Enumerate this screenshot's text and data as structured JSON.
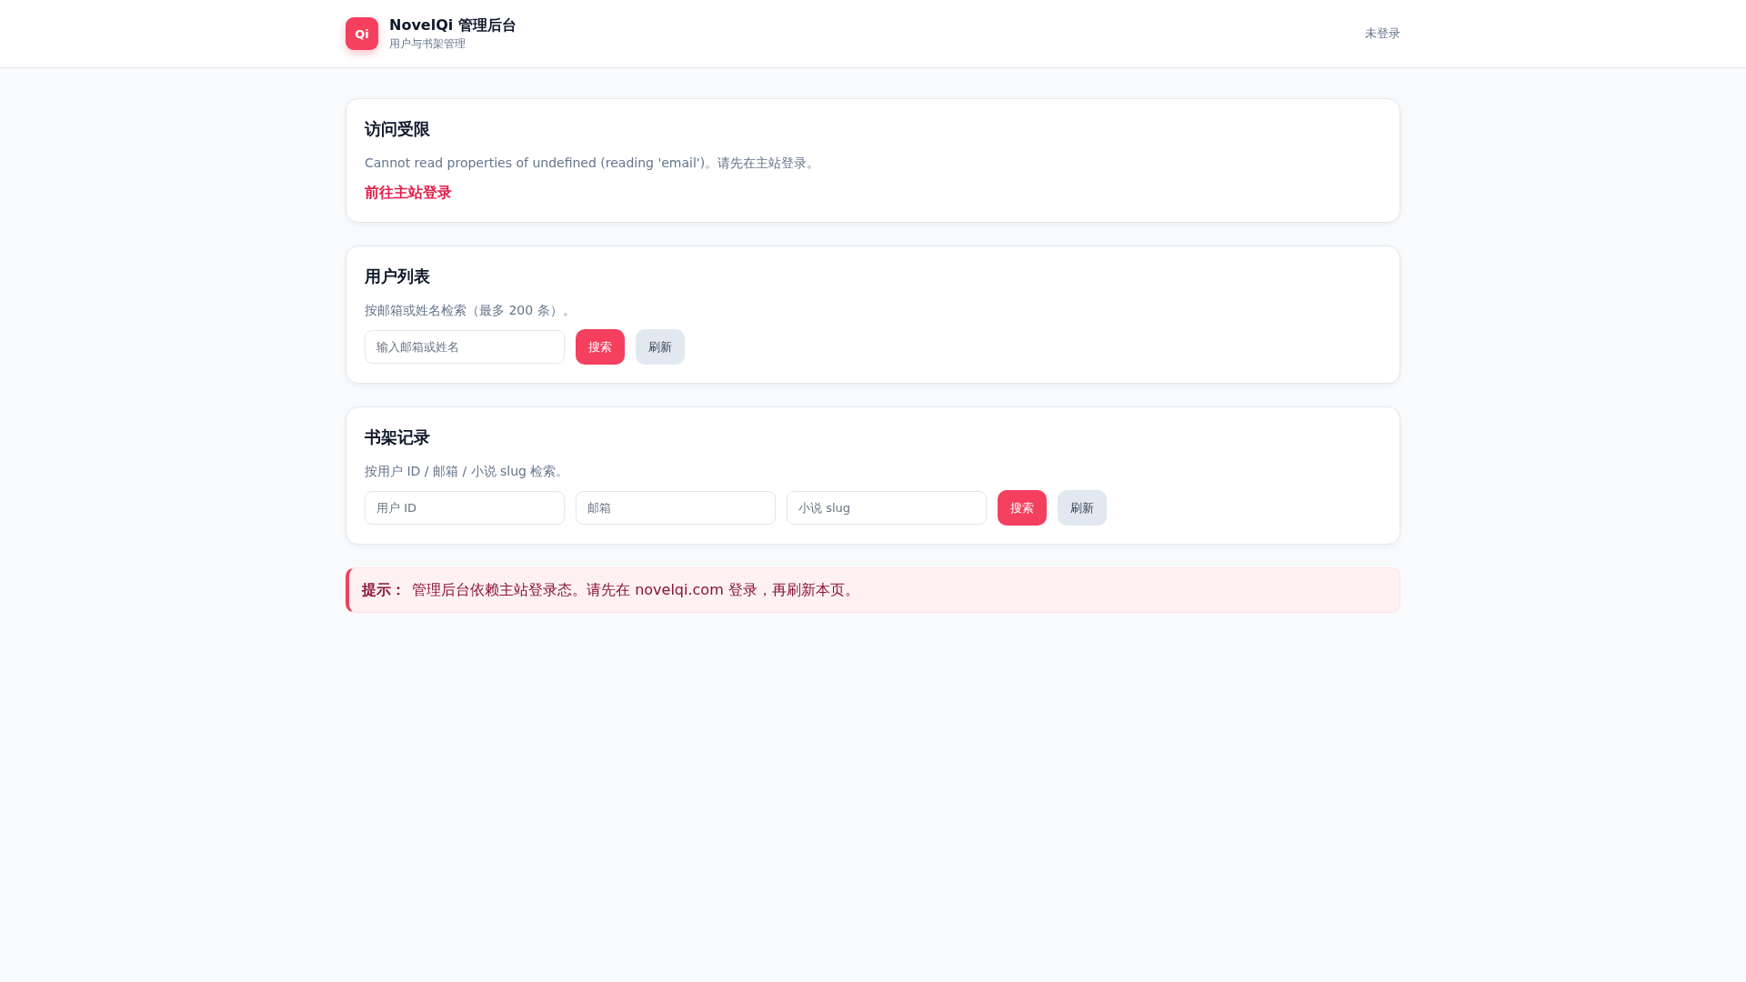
{
  "header": {
    "logo": "Qi",
    "title": "NovelQi 管理后台",
    "subtitle": "用户与书架管理",
    "login_status": "未登录"
  },
  "sections": [
    {
      "kind": "notice",
      "title": "访问受限",
      "description": "Cannot read properties of undefined (reading 'email')。请先在主站登录。",
      "link": "前往主站登录"
    },
    {
      "kind": "search",
      "title": "用户列表",
      "description": "按邮箱或姓名检索（最多 200 条）。",
      "fields": [
        {
          "placeholder": "输入邮箱或姓名"
        }
      ],
      "buttons": [
        {
          "label": "搜索",
          "kind": "primary"
        },
        {
          "label": "刷新",
          "kind": "secondary"
        }
      ]
    },
    {
      "kind": "search",
      "title": "书架记录",
      "description": "按用户 ID / 邮箱 / 小说 slug 检索。",
      "fields": [
        {
          "placeholder": "用户 ID"
        },
        {
          "placeholder": "邮箱"
        },
        {
          "placeholder": "小说 slug"
        }
      ],
      "buttons": [
        {
          "label": "搜索",
          "kind": "primary"
        },
        {
          "label": "刷新",
          "kind": "secondary"
        }
      ]
    }
  ],
  "tip": "**提示：** 管理后台依赖主站登录态。请先在 novelqi.com 登录，再刷新本页。"
}
